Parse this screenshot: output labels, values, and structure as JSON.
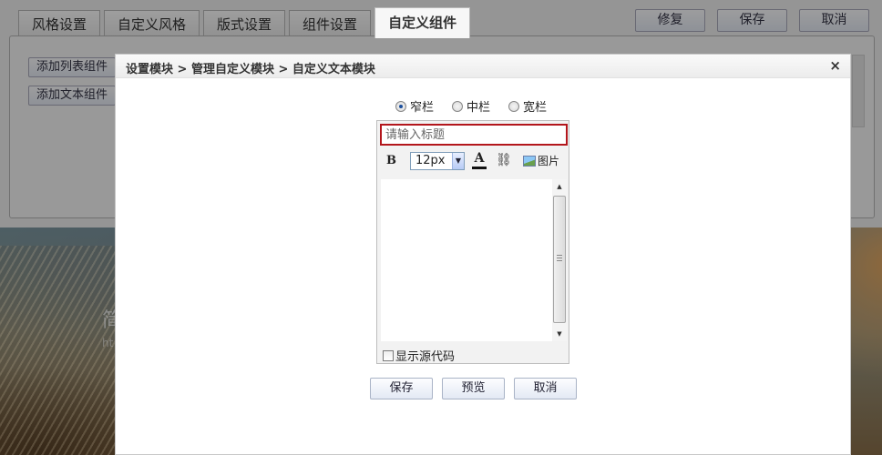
{
  "tabs": [
    {
      "label": "风格设置"
    },
    {
      "label": "自定义风格"
    },
    {
      "label": "版式设置"
    },
    {
      "label": "组件设置"
    },
    {
      "label": "自定义组件",
      "active": true
    }
  ],
  "top_actions": {
    "repair": "修复",
    "save": "保存",
    "cancel": "取消"
  },
  "panel": {
    "add_list_widget": "添加列表组件",
    "add_text_widget": "添加文本组件"
  },
  "background": {
    "ghost_char": "简",
    "ghost_url": "ht"
  },
  "modal": {
    "breadcrumb": "设置模块 > 管理自定义模块 > 自定义文本模块",
    "close": "×",
    "width_options": [
      {
        "label": "窄栏",
        "checked": true
      },
      {
        "label": "中栏",
        "checked": false
      },
      {
        "label": "宽栏",
        "checked": false
      }
    ],
    "title_input": {
      "value": "",
      "placeholder": "请输入标题"
    },
    "toolbar": {
      "bold": "B",
      "font_size": "12px",
      "font_color": "A",
      "link_icon": "link-icon",
      "image_label": "图片"
    },
    "show_source_label": "显示源代码",
    "show_source_checked": false,
    "buttons": {
      "save": "保存",
      "preview": "预览",
      "cancel": "取消"
    }
  },
  "colors": {
    "title_input_border": "#b3161c",
    "radio_checked": "#1c4f9c"
  }
}
